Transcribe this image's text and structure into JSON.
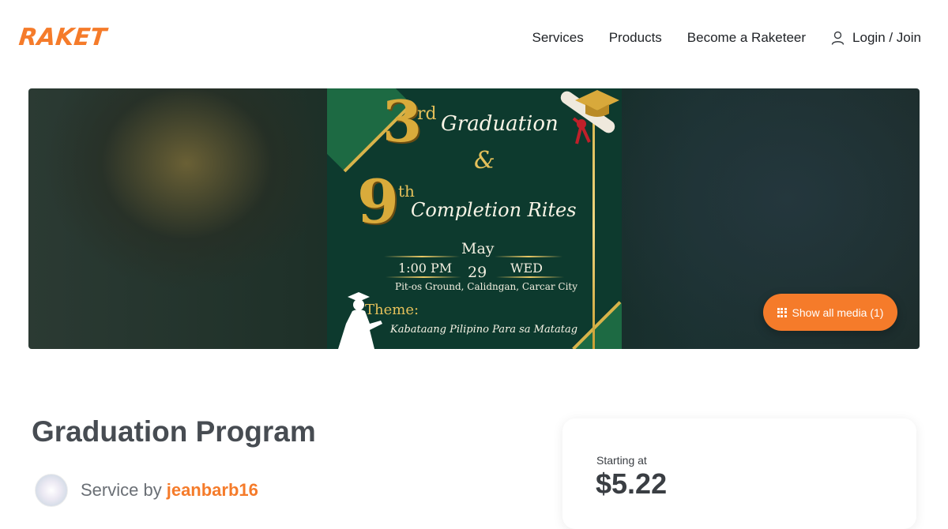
{
  "brand": {
    "name": "RAKET",
    "accent": "#f57b2a"
  },
  "nav": {
    "items": [
      "Services",
      "Products",
      "Become a Raketeer"
    ],
    "login_label": "Login / Join",
    "login_icon": "user-icon"
  },
  "hero": {
    "poster": {
      "num1": "3",
      "sup1": "rd",
      "line1": "Graduation",
      "amp": "&",
      "num2": "9",
      "sup2": "th",
      "line2": "Completion Rites",
      "month": "May",
      "time": "1:00 PM",
      "day": "29",
      "weekday": "WED",
      "venue": "Pit-os Ground, Calidngan, Carcar City",
      "theme_label": "Theme:",
      "theme_text": "Kabataang Pilipino Para sa Matatag"
    },
    "media_button": {
      "label": "Show all media (1)",
      "icon": "grid-icon"
    }
  },
  "listing": {
    "title": "Graduation Program",
    "service_by_prefix": "Service by",
    "seller": "jeanbarb16"
  },
  "pricing": {
    "label": "Starting at",
    "value": "$5.22"
  }
}
